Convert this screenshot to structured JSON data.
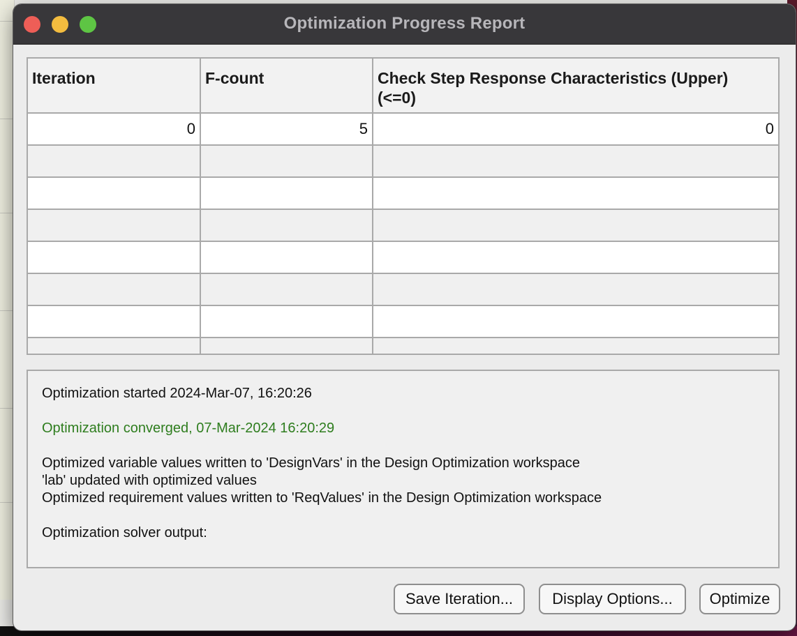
{
  "window": {
    "title": "Optimization Progress Report"
  },
  "table": {
    "columns": [
      "Iteration",
      "F-count",
      "Check Step Response Characteristics (Upper)\n(<=0)"
    ],
    "rows": [
      [
        "0",
        "5",
        "0"
      ],
      [
        "",
        "",
        ""
      ],
      [
        "",
        "",
        ""
      ],
      [
        "",
        "",
        ""
      ],
      [
        "",
        "",
        ""
      ],
      [
        "",
        "",
        ""
      ],
      [
        "",
        "",
        ""
      ],
      [
        "",
        "",
        ""
      ]
    ]
  },
  "log": {
    "started": "Optimization started 2024-Mar-07, 16:20:26",
    "converged": "Optimization converged, 07-Mar-2024 16:20:29",
    "written_vars": "Optimized variable values written to 'DesignVars' in the Design Optimization workspace",
    "updated": "'lab' updated with optimized values",
    "written_reqs": "Optimized requirement values written to 'ReqValues' in the Design Optimization workspace",
    "solver_output": "Optimization solver output:"
  },
  "buttons": {
    "save": "Save Iteration...",
    "display": "Display Options...",
    "optimize": "Optimize"
  },
  "colors": {
    "titlebar": "#38373a",
    "converged_text": "#2e7d1e",
    "close": "#ee5e57",
    "minimize": "#f3bc3f",
    "maximize": "#5ec544"
  }
}
